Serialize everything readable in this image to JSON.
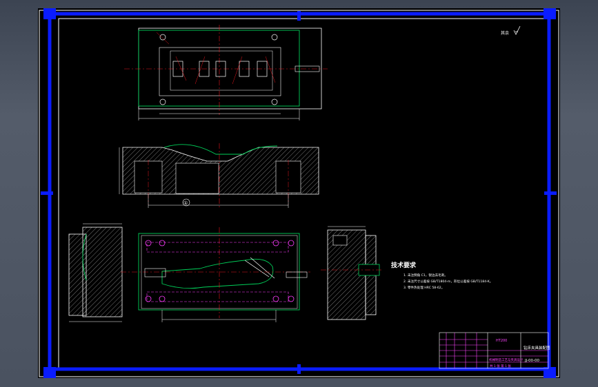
{
  "colors": {
    "frame": "#0a1cff",
    "outline": "#ffffff",
    "part": "#00d25a",
    "center": "#e8171e",
    "dim": "#ffffff",
    "hole": "#ff3cff",
    "section": "#c9c9c9",
    "titleblock": "#ff44ff"
  },
  "roughness_label": "其余",
  "tech_requirements": {
    "title": "技术要求",
    "items": [
      "1. 未注倒角 C1，锐边去毛刺。",
      "2. 未注尺寸公差按 GB/T1804-m，形位公差按 GB/T1184-K。",
      "3. 零件热处理 HRC 58-62。"
    ]
  },
  "section_mark": "①",
  "title_block": {
    "material": "HT200",
    "drawing_name": "钻床夹具装配图",
    "drawing_number": "JJ-00-00",
    "company": "机械制造工艺与夹具设计",
    "sheet": "共 1 张 第 1 张"
  }
}
